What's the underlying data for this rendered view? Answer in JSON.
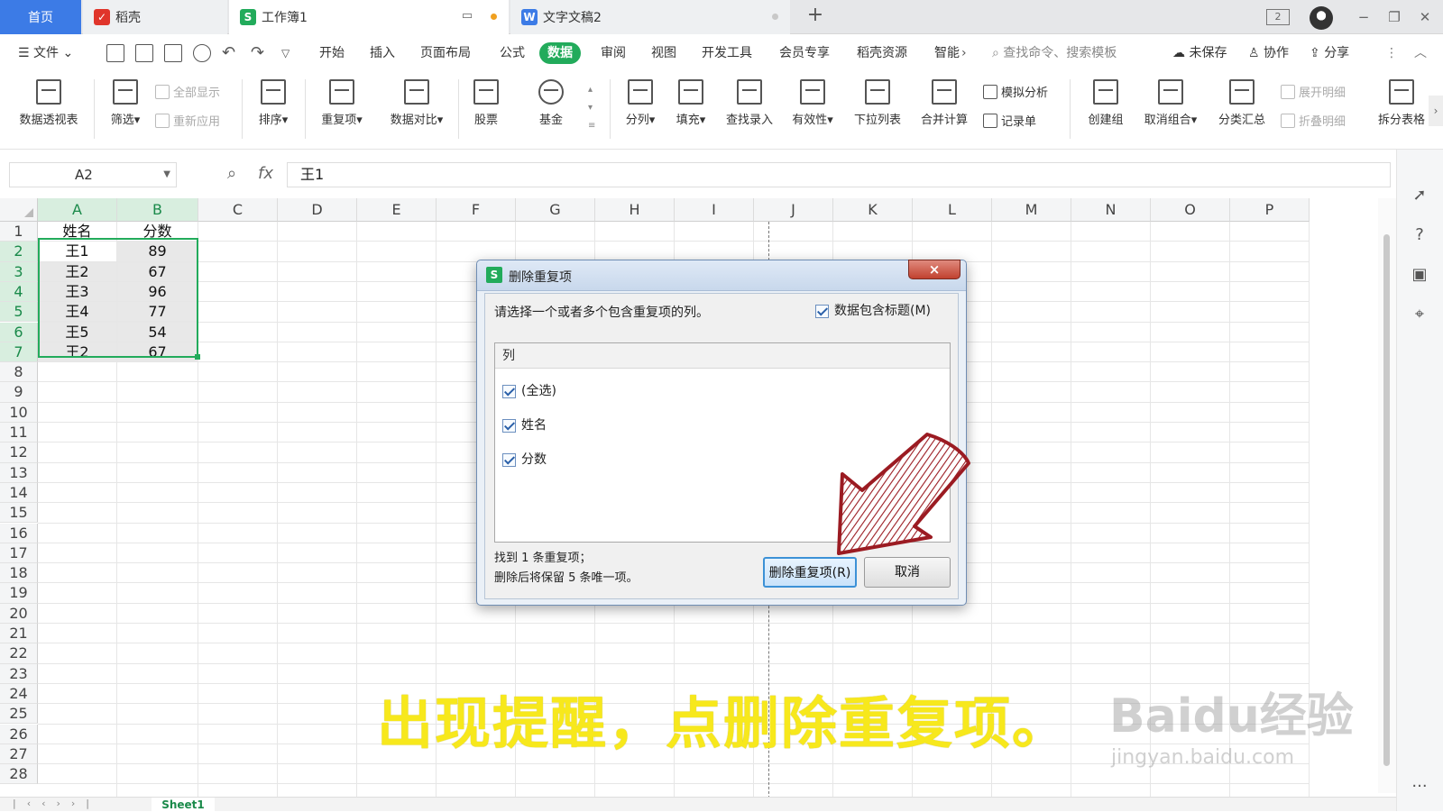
{
  "tabs": [
    {
      "label": "首页"
    },
    {
      "label": "稻壳"
    },
    {
      "label": "工作簿1"
    },
    {
      "label": "文字文稿2"
    }
  ],
  "tab_new": "+",
  "window_badge": "2",
  "menu": {
    "file": "文件",
    "items": [
      "开始",
      "插入",
      "页面布局",
      "公式",
      "数据",
      "审阅",
      "视图",
      "开发工具",
      "会员专享",
      "稻壳资源",
      "智能"
    ],
    "active": "数据",
    "search_placeholder": "查找命令、搜索模板",
    "unsaved": "未保存",
    "collab": "协作",
    "share": "分享"
  },
  "ribbon": {
    "pivot": "数据透视表",
    "filter": "筛选",
    "show_all": "全部显示",
    "reapply": "重新应用",
    "sort": "排序",
    "duplicates": "重复项",
    "compare": "数据对比",
    "stock": "股票",
    "fund": "基金",
    "split": "分列",
    "fill": "填充",
    "lookup": "查找录入",
    "validity": "有效性",
    "dropdown": "下拉列表",
    "consolidate": "合并计算",
    "simulate": "模拟分析",
    "record": "记录单",
    "group": "创建组",
    "ungroup": "取消组合",
    "subtotal": "分类汇总",
    "expand": "展开明细",
    "collapse": "折叠明细",
    "split_table": "拆分表格"
  },
  "formula_bar": {
    "cell_ref": "A2",
    "fx": "fx",
    "content": "王1"
  },
  "columns": [
    "A",
    "B",
    "C",
    "D",
    "E",
    "F",
    "G",
    "H",
    "I",
    "J",
    "K",
    "L",
    "M",
    "N",
    "O",
    "P"
  ],
  "rows": [
    "1",
    "2",
    "3",
    "4",
    "5",
    "6",
    "7",
    "8",
    "9",
    "10",
    "11",
    "12",
    "13",
    "14",
    "15",
    "16",
    "17",
    "18",
    "19",
    "20",
    "21",
    "22",
    "23",
    "24",
    "25",
    "26",
    "27",
    "28"
  ],
  "table": {
    "header": [
      "姓名",
      "分数"
    ],
    "rows": [
      [
        "王1",
        "89"
      ],
      [
        "王2",
        "67"
      ],
      [
        "王3",
        "96"
      ],
      [
        "王4",
        "77"
      ],
      [
        "王5",
        "54"
      ],
      [
        "王2",
        "67"
      ]
    ]
  },
  "sheet_tab": "Sheet1",
  "dialog": {
    "title": "删除重复项",
    "close": "×",
    "instruction": "请选择一个或者多个包含重复项的列。",
    "has_header": "数据包含标题(M)",
    "list_header": "列",
    "items": [
      "(全选)",
      "姓名",
      "分数"
    ],
    "summary_line1": "找到 1 条重复项；",
    "summary_line2": "删除后将保留 5 条唯一项。",
    "btn_delete": "删除重复项(R)",
    "btn_cancel": "取消"
  },
  "caption": "出现提醒，点删除重复项。",
  "watermark": {
    "big": "Baidu经验",
    "small": "jingyan.baidu.com"
  },
  "colors": {
    "accent_green": "#22ab5b",
    "home_tab": "#3c7be6",
    "caption": "#f7e81c",
    "arrow": "#9b1b22"
  }
}
